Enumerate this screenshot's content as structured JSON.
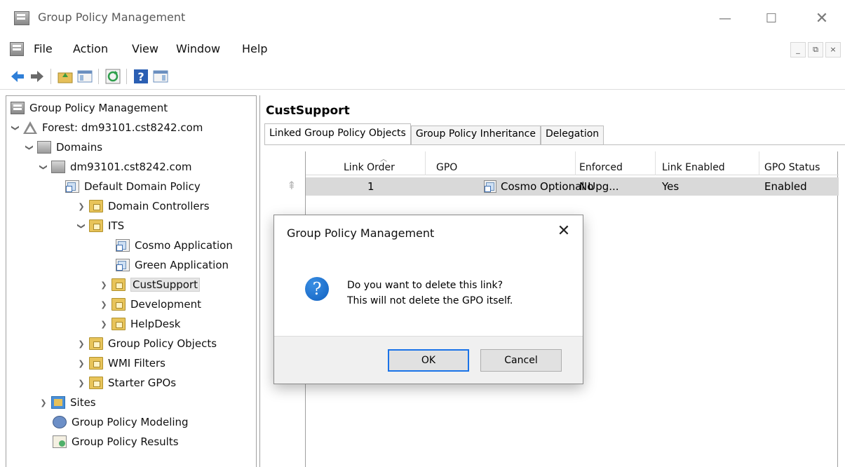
{
  "window": {
    "title": "Group Policy Management",
    "controls": {
      "minimize": "—",
      "maximize": "☐",
      "close": "✕"
    }
  },
  "menubar": {
    "items": [
      "File",
      "Action",
      "View",
      "Window",
      "Help"
    ],
    "mdi_controls": [
      "_",
      "⧉",
      "×"
    ]
  },
  "toolbar": {
    "buttons": [
      "back-icon",
      "forward-icon",
      "up-folder-icon",
      "show-hide-tree-icon",
      "refresh-icon",
      "help-icon",
      "show-action-pane-icon"
    ]
  },
  "tree": {
    "root": "Group Policy Management",
    "forest": "Forest: dm93101.cst8242.com",
    "domains": "Domains",
    "domain": "dm93101.cst8242.com",
    "default_policy": "Default Domain Policy",
    "domain_controllers": "Domain Controllers",
    "its": "ITS",
    "cosmo_app": "Cosmo Application",
    "green_app": "Green Application",
    "custsupport": "CustSupport",
    "development": "Development",
    "helpdesk": "HelpDesk",
    "gpo_objects": "Group Policy Objects",
    "wmi_filters": "WMI Filters",
    "starter_gpos": "Starter GPOs",
    "sites": "Sites",
    "modeling": "Group Policy Modeling",
    "results": "Group Policy Results"
  },
  "detail": {
    "title": "CustSupport",
    "tabs": [
      "Linked Group Policy Objects",
      "Group Policy Inheritance",
      "Delegation"
    ],
    "columns": [
      "Link Order",
      "GPO",
      "Enforced",
      "Link Enabled",
      "GPO Status"
    ],
    "rows": [
      {
        "link_order": "1",
        "gpo": "Cosmo Optional Upg...",
        "enforced": "No",
        "link_enabled": "Yes",
        "gpo_status": "Enabled"
      }
    ]
  },
  "dialog": {
    "title": "Group Policy Management",
    "close": "✕",
    "icon": "?",
    "message_line1": "Do you want to delete this link?",
    "message_line2": "This will not delete the GPO itself.",
    "ok_label": "OK",
    "cancel_label": "Cancel"
  },
  "colors": {
    "selection_row": "#d9d9d9",
    "accent": "#1a73e8",
    "question_icon": "#1565c0"
  }
}
